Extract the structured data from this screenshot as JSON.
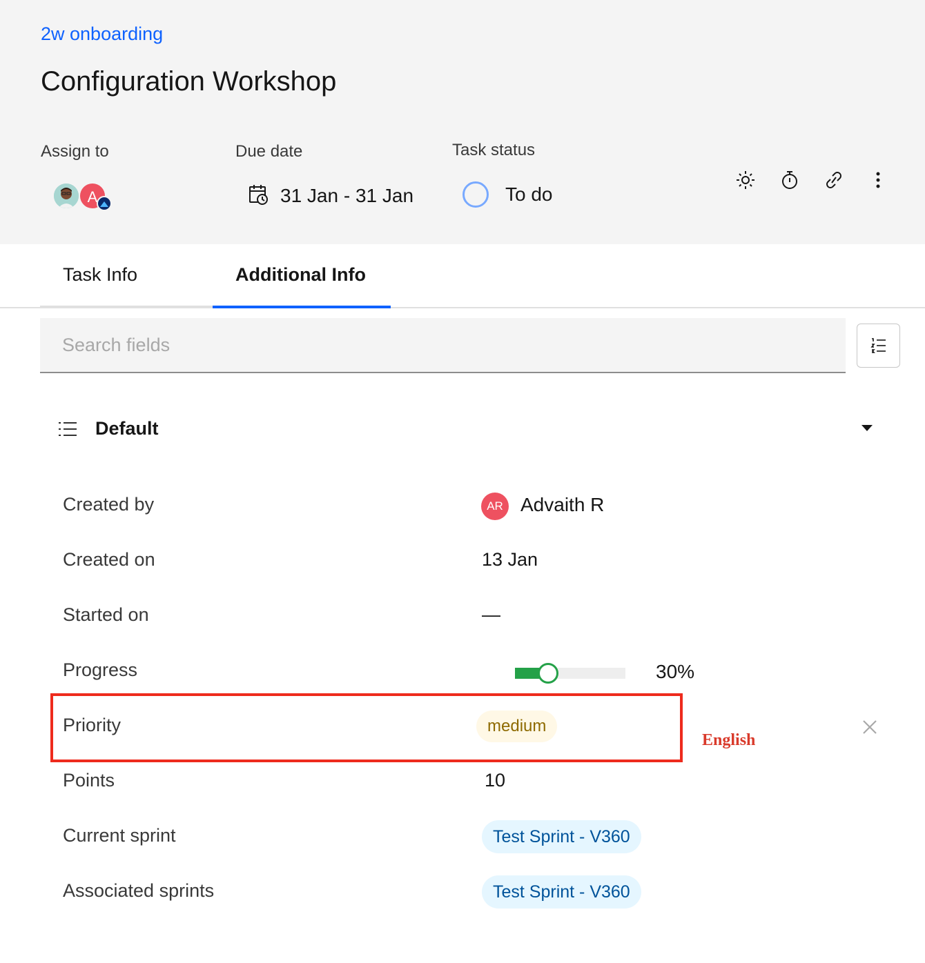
{
  "header": {
    "breadcrumb": "2w onboarding",
    "title": "Configuration Workshop",
    "assign_label": "Assign to",
    "due_label": "Due date",
    "status_label": "Task status",
    "assignee_initial": "A",
    "due_value": "31 Jan - 31 Jan",
    "status_value": "To do",
    "toolbar_icons": [
      "sun-icon",
      "stopwatch-icon",
      "link-icon",
      "overflow-menu-icon"
    ]
  },
  "tabs": [
    {
      "label": "Task Info",
      "active": false
    },
    {
      "label": "Additional Info",
      "active": true
    }
  ],
  "search": {
    "placeholder": "Search fields"
  },
  "section": {
    "title": "Default",
    "expanded": true
  },
  "fields": {
    "created_by": {
      "label": "Created by",
      "initials": "AR",
      "name": "Advaith R"
    },
    "created_on": {
      "label": "Created on",
      "value": "13 Jan"
    },
    "started_on": {
      "label": "Started on",
      "value": "—"
    },
    "progress": {
      "label": "Progress",
      "value_text": "30%",
      "fraction": 0.3
    },
    "priority": {
      "label": "Priority",
      "value": "medium"
    },
    "points": {
      "label": "Points",
      "value": "10"
    },
    "current_sprint": {
      "label": "Current sprint",
      "value": "Test Sprint - V360"
    },
    "associated_sprints": {
      "label": "Associated sprints",
      "value": "Test Sprint - V360"
    }
  },
  "annotation": "English",
  "colors": {
    "accent": "#0f62fe",
    "status_ring": "#78a9ff",
    "progress": "#24a148",
    "priority_bg": "#fff8e6",
    "priority_text": "#8e6a00",
    "sprint_bg": "#e5f6ff",
    "sprint_text": "#00539a",
    "highlight": "#ee2b1d"
  }
}
